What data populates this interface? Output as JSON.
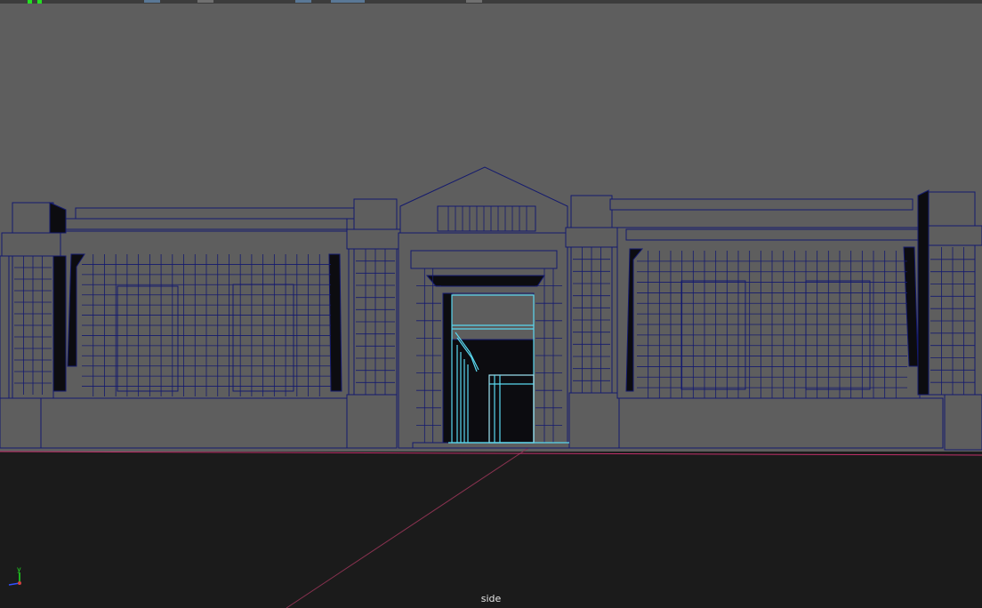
{
  "viewport": {
    "camera_label": "side",
    "axis_label": "y",
    "colors": {
      "background_upper": "#5e5e5e",
      "background_lower": "#1b1b1b",
      "wireframe": "#141a6e",
      "selection": "#5ad8f0",
      "ground_line": "#c0306a"
    }
  },
  "toolbar": {
    "buttons": [
      "toolbar-btn-1",
      "toolbar-btn-2",
      "toolbar-btn-3",
      "toolbar-btn-4",
      "toolbar-btn-5"
    ]
  }
}
